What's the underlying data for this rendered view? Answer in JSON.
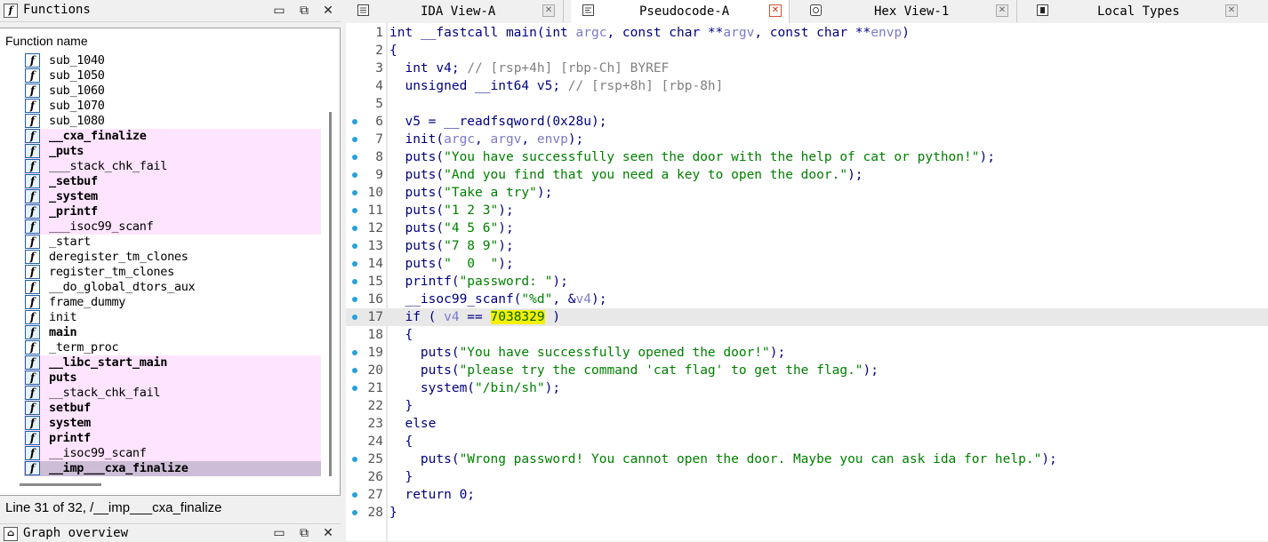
{
  "functions_panel": {
    "title": "Functions",
    "column_header": "Function name",
    "items": [
      {
        "name": "sub_1040",
        "style": "normal"
      },
      {
        "name": "sub_1050",
        "style": "normal"
      },
      {
        "name": "sub_1060",
        "style": "normal"
      },
      {
        "name": "sub_1070",
        "style": "normal"
      },
      {
        "name": "sub_1080",
        "style": "normal"
      },
      {
        "name": "__cxa_finalize",
        "style": "pink-bold"
      },
      {
        "name": "_puts",
        "style": "pink-bold"
      },
      {
        "name": "___stack_chk_fail",
        "style": "pink"
      },
      {
        "name": "_setbuf",
        "style": "pink-bold"
      },
      {
        "name": "_system",
        "style": "pink-bold"
      },
      {
        "name": "_printf",
        "style": "pink-bold"
      },
      {
        "name": "___isoc99_scanf",
        "style": "pink"
      },
      {
        "name": "_start",
        "style": "normal"
      },
      {
        "name": "deregister_tm_clones",
        "style": "normal"
      },
      {
        "name": "register_tm_clones",
        "style": "normal"
      },
      {
        "name": "__do_global_dtors_aux",
        "style": "normal"
      },
      {
        "name": "frame_dummy",
        "style": "normal"
      },
      {
        "name": "init",
        "style": "normal"
      },
      {
        "name": "main",
        "style": "bold"
      },
      {
        "name": "_term_proc",
        "style": "normal"
      },
      {
        "name": "__libc_start_main",
        "style": "pink-bold"
      },
      {
        "name": "puts",
        "style": "pink-bold"
      },
      {
        "name": "__stack_chk_fail",
        "style": "pink"
      },
      {
        "name": "setbuf",
        "style": "pink-bold"
      },
      {
        "name": "system",
        "style": "pink-bold"
      },
      {
        "name": "printf",
        "style": "pink-bold"
      },
      {
        "name": "__isoc99_scanf",
        "style": "pink"
      },
      {
        "name": "__imp___cxa_finalize",
        "style": "selected-bold"
      }
    ],
    "status": "Line 31 of 32, /__imp___cxa_finalize"
  },
  "graph_overview": {
    "title": "Graph overview"
  },
  "tabs": [
    {
      "label": "IDA View-A",
      "icon": "ida-view-icon",
      "active": false
    },
    {
      "label": "Pseudocode-A",
      "icon": "pseudocode-icon",
      "active": true
    },
    {
      "label": "Hex View-1",
      "icon": "hex-view-icon",
      "active": false
    },
    {
      "label": "Local Types",
      "icon": "local-types-icon",
      "active": false
    }
  ],
  "code": {
    "highlighted_line": 17,
    "lines": [
      {
        "n": "1",
        "dot": false,
        "text": "int __fastcall main(int argc, const char **argv, const char **envp)"
      },
      {
        "n": "2",
        "dot": false,
        "text": "{"
      },
      {
        "n": "3",
        "dot": false,
        "text": "  int v4; // [rsp+4h] [rbp-Ch] BYREF"
      },
      {
        "n": "4",
        "dot": false,
        "text": "  unsigned __int64 v5; // [rsp+8h] [rbp-8h]"
      },
      {
        "n": "5",
        "dot": false,
        "text": ""
      },
      {
        "n": "6",
        "dot": true,
        "text": "  v5 = __readfsqword(0x28u);"
      },
      {
        "n": "7",
        "dot": true,
        "text": "  init(argc, argv, envp);"
      },
      {
        "n": "8",
        "dot": true,
        "text": "  puts(\"You have successfully seen the door with the help of cat or python!\");"
      },
      {
        "n": "9",
        "dot": true,
        "text": "  puts(\"And you find that you need a key to open the door.\");"
      },
      {
        "n": "10",
        "dot": true,
        "text": "  puts(\"Take a try\");"
      },
      {
        "n": "11",
        "dot": true,
        "text": "  puts(\"1 2 3\");"
      },
      {
        "n": "12",
        "dot": true,
        "text": "  puts(\"4 5 6\");"
      },
      {
        "n": "13",
        "dot": true,
        "text": "  puts(\"7 8 9\");"
      },
      {
        "n": "14",
        "dot": true,
        "text": "  puts(\"  0  \");"
      },
      {
        "n": "15",
        "dot": true,
        "text": "  printf(\"password: \");"
      },
      {
        "n": "16",
        "dot": true,
        "text": "  __isoc99_scanf(\"%d\", &v4);"
      },
      {
        "n": "17",
        "dot": true,
        "text": "  if ( v4 == 7038329 )"
      },
      {
        "n": "18",
        "dot": false,
        "text": "  {"
      },
      {
        "n": "19",
        "dot": true,
        "text": "    puts(\"You have successfully opened the door!\");"
      },
      {
        "n": "20",
        "dot": true,
        "text": "    puts(\"please try the command 'cat flag' to get the flag.\");"
      },
      {
        "n": "21",
        "dot": true,
        "text": "    system(\"/bin/sh\");"
      },
      {
        "n": "22",
        "dot": false,
        "text": "  }"
      },
      {
        "n": "23",
        "dot": false,
        "text": "  else"
      },
      {
        "n": "24",
        "dot": false,
        "text": "  {"
      },
      {
        "n": "25",
        "dot": true,
        "text": "    puts(\"Wrong password! You cannot open the door. Maybe you can ask ida for help.\");"
      },
      {
        "n": "26",
        "dot": false,
        "text": "  }"
      },
      {
        "n": "27",
        "dot": true,
        "text": "  return 0;"
      },
      {
        "n": "28",
        "dot": true,
        "text": "}"
      }
    ]
  },
  "colors": {
    "keyword": "#000080",
    "string": "#008000",
    "comment": "#808080",
    "variable": "#7a7ac8",
    "number_highlight": "#f5f000",
    "import_row": "#ffe4ff",
    "selected_row": "#cdbdd6",
    "breakpoint_dot": "#2aa0d8"
  }
}
